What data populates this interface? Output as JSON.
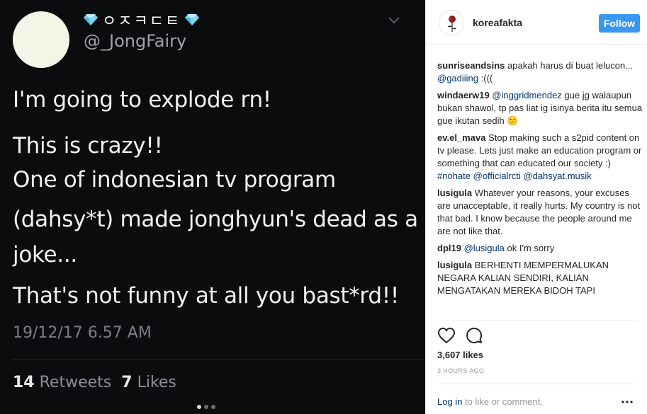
{
  "tweet": {
    "display_name_text": "ㅇㅈㅋㄷㅌ",
    "handle": "@_JongFairy",
    "lines": [
      "I'm going to explode rn!",
      "This is crazy!!",
      "One of indonesian tv program",
      "(dahsy*t) made jonghyun's dead as a",
      "joke...",
      "That's not funny at all you bast*rd!!"
    ],
    "date": "19/12/17 6.57 AM",
    "retweets_count": "14",
    "retweets_label": "Retweets",
    "likes_count": "7",
    "likes_label": "Likes"
  },
  "post": {
    "username": "koreafakta",
    "follow_label": "Follow",
    "likes": "3,607 likes",
    "time": "3 HOURS AGO",
    "login_link": "Log in",
    "login_rest": " to like or comment.",
    "more_icon": "more-horizontal-icon"
  },
  "comments": [
    {
      "user": "sunriseandsins",
      "parts": [
        {
          "t": "apakah harus di buat lelucon... "
        },
        {
          "t": "@gadiiing",
          "link": true
        },
        {
          "t": " :((("
        }
      ]
    },
    {
      "user": "windaerw19",
      "parts": [
        {
          "t": "@inggridmendez",
          "link": true
        },
        {
          "t": " gue jg walaupun bukan shawol, tp pas liat ig isinya berita itu semua gue ikutan sedih 😕"
        }
      ]
    },
    {
      "user": "ev.el_mava",
      "parts": [
        {
          "t": "Stop making such a s2pid content on tv please. Lets just make an education program or something that can educated our society :) "
        },
        {
          "t": "#nohate",
          "link": true
        },
        {
          "t": " "
        },
        {
          "t": "@officialrcti",
          "link": true
        },
        {
          "t": " "
        },
        {
          "t": "@dahsyat.musik",
          "link": true
        }
      ]
    },
    {
      "user": "lusigula",
      "parts": [
        {
          "t": "Whatever your reasons, your excuses are unacceptable, it really hurts. My country is not that bad. I know because the people around me are not like that."
        }
      ]
    },
    {
      "user": "dpl19",
      "parts": [
        {
          "t": "@lusigula",
          "link": true
        },
        {
          "t": " ok I'm sorry"
        }
      ]
    },
    {
      "user": "lusigula",
      "parts": [
        {
          "t": "BERHENTI MEMPERMALUKAN NEGARA KALIAN SENDIRI, KALIAN MENGATAKAN MEREKA BIDOH TAPI"
        }
      ]
    }
  ],
  "colors": {
    "follow_button": "#3897f0",
    "link": "#003569",
    "tweet_background": "#0b0c0e"
  }
}
